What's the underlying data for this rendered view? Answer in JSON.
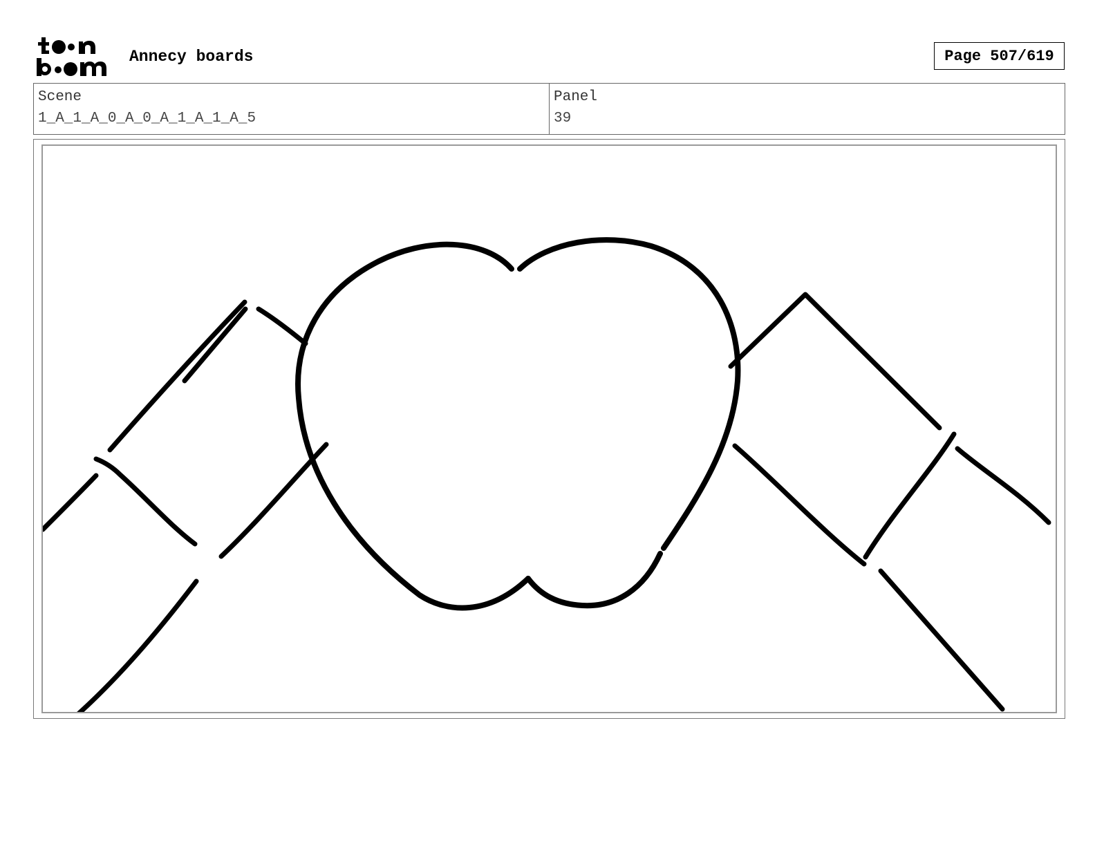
{
  "header": {
    "logo_lines": [
      "toon",
      "boom"
    ],
    "title": "Annecy boards",
    "page_label": "Page 507/619"
  },
  "info": {
    "scene_label": "Scene",
    "scene_value": "1_A_1_A_0_A_0_A_1_A_1_A_5",
    "panel_label": "Panel",
    "panel_value": "39"
  },
  "panel": {
    "image": "heart-shape-sketch"
  }
}
